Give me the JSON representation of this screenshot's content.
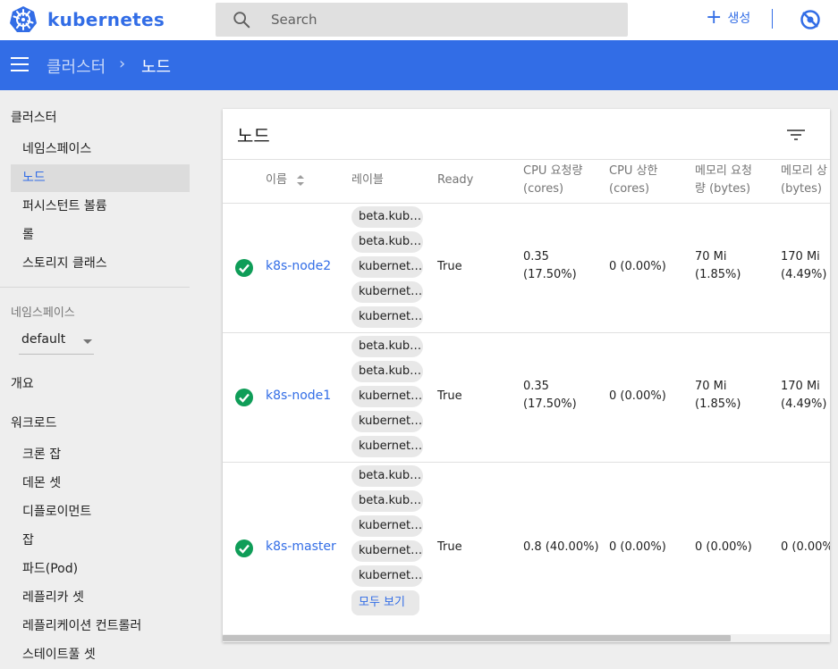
{
  "app": {
    "brand": "kubernetes"
  },
  "search": {
    "placeholder": "Search"
  },
  "topbar": {
    "create_label": "생성"
  },
  "breadcrumb": {
    "parent": "클러스터",
    "separator": "›",
    "current": "노드"
  },
  "sidebar": {
    "cluster_heading": "클러스터",
    "cluster_items": [
      "네임스페이스",
      "노드",
      "퍼시스턴트 볼륨",
      "롤",
      "스토리지 클래스"
    ],
    "active_item": "노드",
    "namespace_label": "네임스페이스",
    "namespace_value": "default",
    "overview": "개요",
    "workloads_heading": "워크로드",
    "workload_items": [
      "크론 잡",
      "데몬 셋",
      "디플로이먼트",
      "잡",
      "파드(Pod)",
      "레플리카 셋",
      "레플리케이션 컨트롤러",
      "스테이트풀 셋"
    ]
  },
  "card": {
    "title": "노드",
    "columns": [
      "이름",
      "레이블",
      "Ready",
      "CPU 요청량",
      "(cores)",
      "CPU 상한",
      "(cores)",
      "메모리 요청",
      "량 (bytes)",
      "메모리 상",
      "(bytes)"
    ],
    "show_all": "모두 보기",
    "rows": [
      {
        "name": "k8s-node2",
        "labels": [
          "beta.kuber...",
          "beta.kuber...",
          "kubernete...",
          "kubernete...",
          "kubernete..."
        ],
        "ready": "True",
        "cpu_req": [
          "0.35",
          "(17.50%)"
        ],
        "cpu_lim": "0 (0.00%)",
        "mem_req": [
          "70 Mi",
          "(1.85%)"
        ],
        "mem_lim": [
          "170 Mi",
          "(4.49%)"
        ]
      },
      {
        "name": "k8s-node1",
        "labels": [
          "beta.kuber...",
          "beta.kuber...",
          "kubernete...",
          "kubernete...",
          "kubernete..."
        ],
        "ready": "True",
        "cpu_req": [
          "0.35",
          "(17.50%)"
        ],
        "cpu_lim": "0 (0.00%)",
        "mem_req": [
          "70 Mi",
          "(1.85%)"
        ],
        "mem_lim": [
          "170 Mi",
          "(4.49%)"
        ]
      },
      {
        "name": "k8s-master",
        "labels": [
          "beta.kuber...",
          "beta.kuber...",
          "kubernete...",
          "kubernete...",
          "kubernete..."
        ],
        "ready": "True",
        "cpu_req": [
          "0.8 (40.00%)"
        ],
        "cpu_lim": "0 (0.00%)",
        "mem_req": [
          "0 (0.00%)"
        ],
        "mem_lim": [
          "0 (0.00%"
        ]
      }
    ]
  },
  "colors": {
    "accent": "#326de6",
    "status_ok": "#0f9d58"
  }
}
